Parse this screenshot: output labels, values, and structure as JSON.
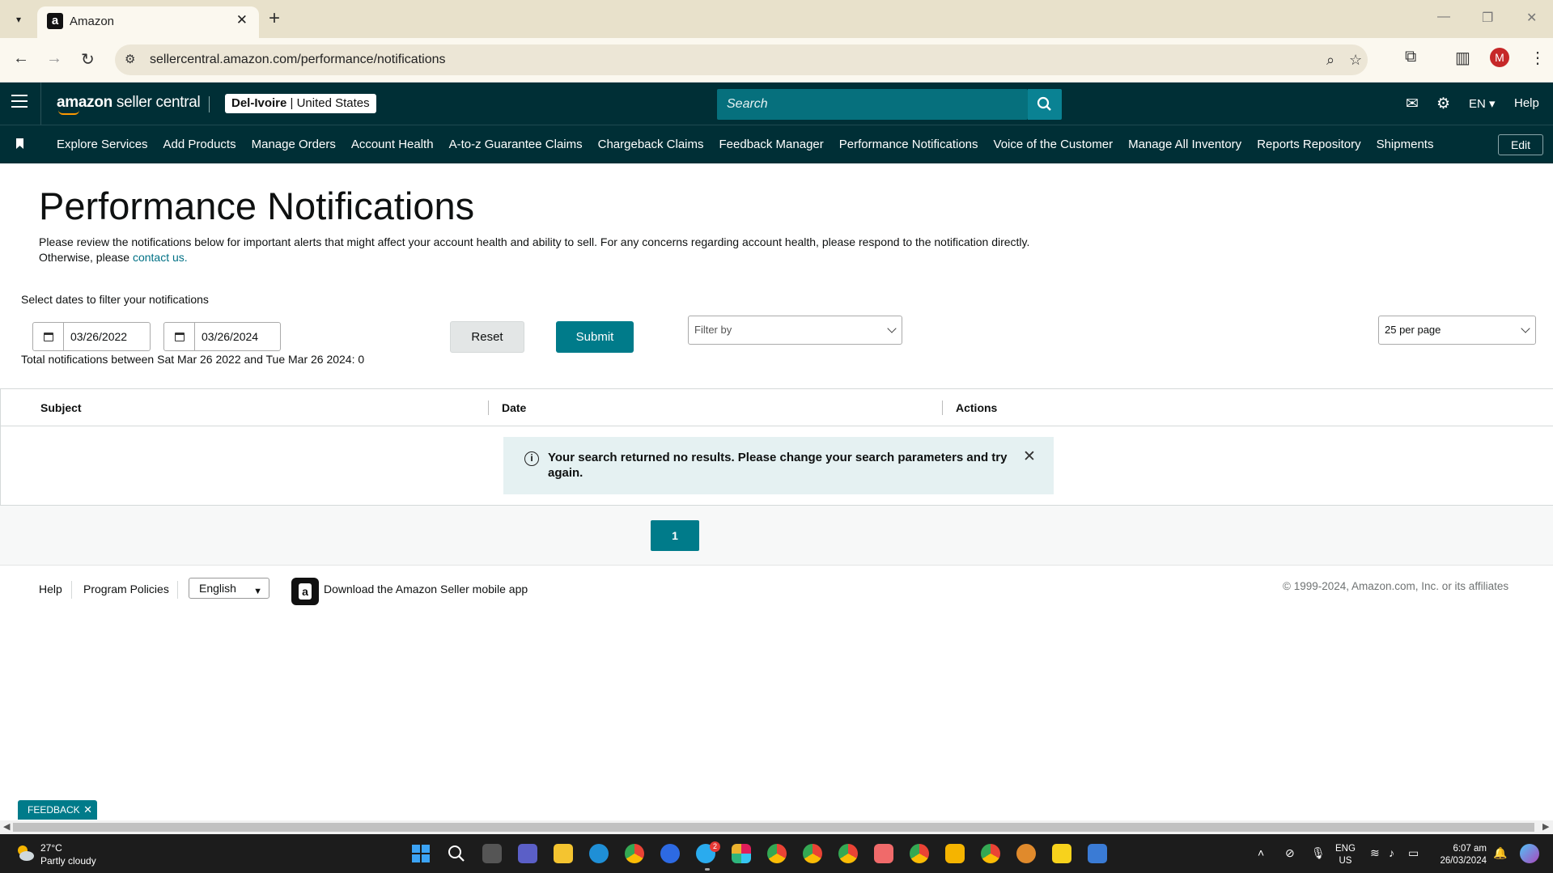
{
  "browser": {
    "tab_title": "Amazon",
    "url": "sellercentral.amazon.com/performance/notifications"
  },
  "header": {
    "logo_brand": "amazon",
    "logo_suffix": " seller central",
    "marketplace_store": "Del-Ivoire",
    "marketplace_sep": " | ",
    "marketplace_country": "United States",
    "search_placeholder": "Search",
    "language": "EN",
    "help": "Help"
  },
  "nav": {
    "items": [
      "Explore Services",
      "Add Products",
      "Manage Orders",
      "Account Health",
      "A-to-z Guarantee Claims",
      "Chargeback Claims",
      "Feedback Manager",
      "Performance Notifications",
      "Voice of the Customer",
      "Manage All Inventory",
      "Reports Repository",
      "Shipments"
    ],
    "edit": "Edit"
  },
  "main": {
    "title": "Performance Notifications",
    "description_line1": "Please review the notifications below for important alerts that might affect your account health and ability to sell. For any concerns regarding account health, please respond to the notification directly.",
    "description_line2_prefix": "Otherwise, please ",
    "contact_link": "contact us.",
    "filter_label": "Select dates to filter your notifications",
    "start_date": "03/26/2022",
    "end_date": "03/26/2024",
    "reset": "Reset",
    "submit": "Submit",
    "filter_by_placeholder": "Filter by",
    "per_page": "25 per page",
    "total_text": "Total notifications between Sat Mar 26 2022 and Tue Mar 26 2024: 0"
  },
  "table": {
    "columns": [
      "Subject",
      "Date",
      "Actions"
    ],
    "alert": "Your search returned no results. Please change your search parameters and try again.",
    "page": "1"
  },
  "footer": {
    "help": "Help",
    "program_policies": "Program Policies",
    "language": "English",
    "app_download": "Download the Amazon Seller mobile app",
    "copyright": "© 1999-2024, Amazon.com, Inc. or its affiliates",
    "feedback": "FEEDBACK"
  },
  "taskbar": {
    "temp": "27°C",
    "weather": "Partly cloudy",
    "lang_line1": "ENG",
    "lang_line2": "US",
    "time": "6:07 am",
    "date": "26/03/2024",
    "telegram_badge": "2"
  },
  "colors": {
    "header_bg": "#002f36",
    "accent": "#007b8a",
    "alert_bg": "#e5f1f2"
  }
}
